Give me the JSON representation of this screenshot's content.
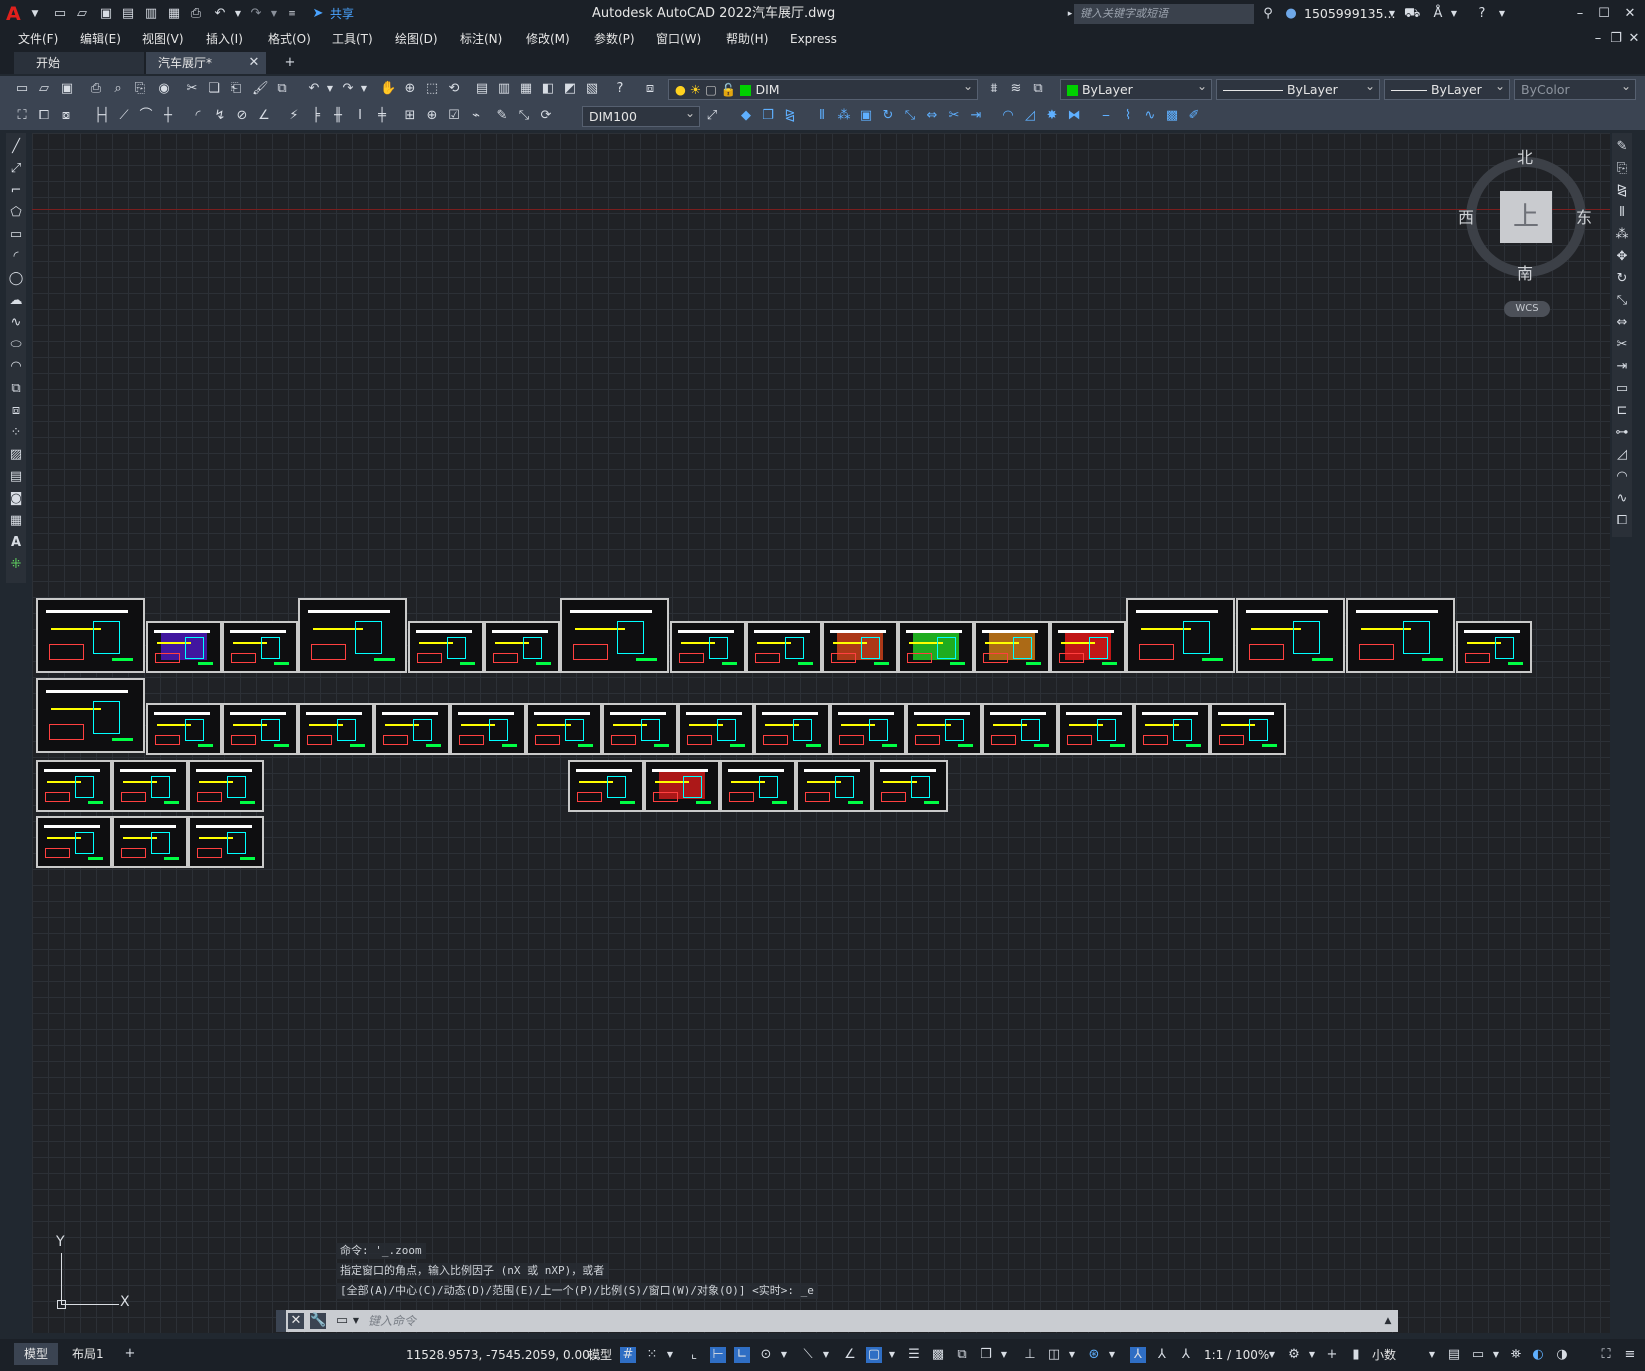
{
  "app_title": "Autodesk AutoCAD 2022",
  "file_title": "汽车展厅.dwg",
  "share_label": "共享",
  "search_placeholder": "键入关键字或短语",
  "user_name": "1505999135...",
  "menu": [
    "文件(F)",
    "编辑(E)",
    "视图(V)",
    "插入(I)",
    "格式(O)",
    "工具(T)",
    "绘图(D)",
    "标注(N)",
    "修改(M)",
    "参数(P)",
    "窗口(W)",
    "帮助(H)",
    "Express"
  ],
  "tabs": {
    "start": "开始",
    "active": "汽车展厅*"
  },
  "layer_combo": "DIM",
  "color_combo": "ByLayer",
  "linetype_combo": "ByLayer",
  "lineweight_combo": "ByLayer",
  "plotstyle_combo": "ByColor",
  "dimstyle_combo": "DIM100",
  "viewcube": {
    "north": "北",
    "south": "南",
    "east": "东",
    "west": "西",
    "face": "上",
    "wcs": "WCS"
  },
  "ucs": {
    "x": "X",
    "y": "Y"
  },
  "command_history": [
    "命令: '_.zoom",
    "指定窗口的角点，输入比例因子 (nX 或 nXP)，或者",
    "[全部(A)/中心(C)/动态(D)/范围(E)/上一个(P)/比例(S)/窗口(W)/对象(O)] <实时>: _e"
  ],
  "command_placeholder": "键入命令",
  "layout_tabs": [
    "模型",
    "布局1"
  ],
  "coordinates": "11528.9573, -7545.2059, 0.00...",
  "status_model": "模型",
  "annotation_scale": "1:1 / 100%",
  "units_label": "小数",
  "colors": {
    "accent": "#2f6ec4",
    "bg": "#212830",
    "canvas": "#202226",
    "grid": "#2c3036",
    "sheet_border": "#c9c9c9"
  }
}
